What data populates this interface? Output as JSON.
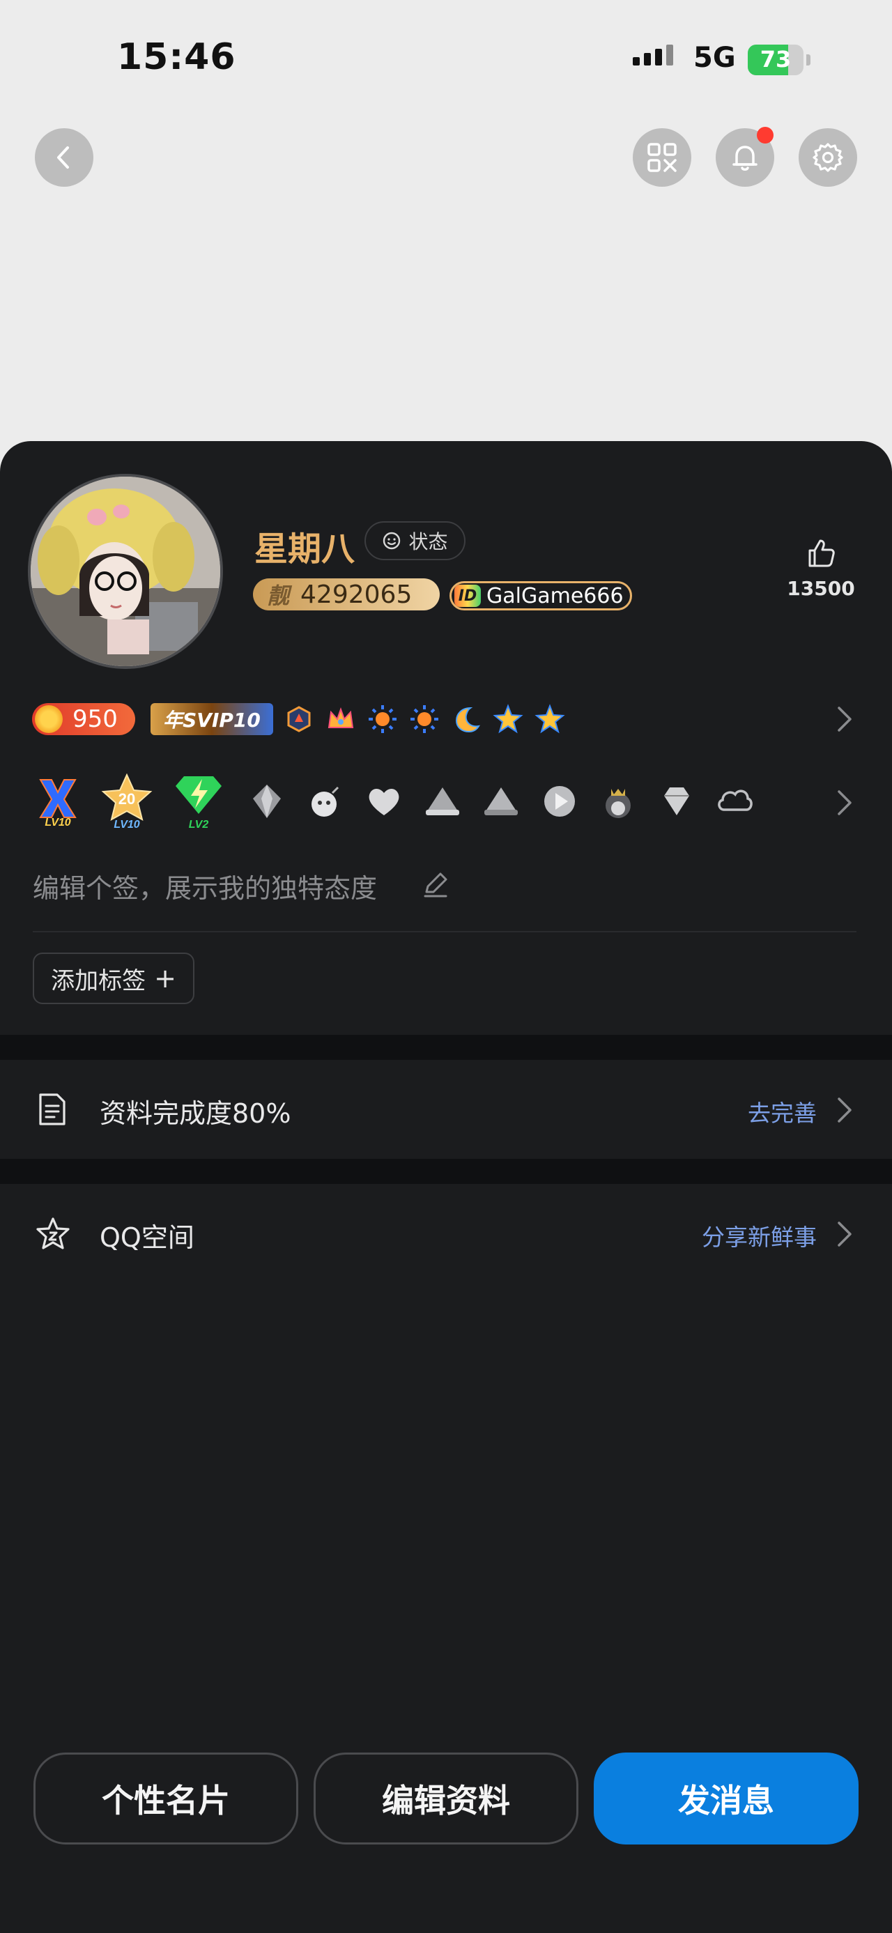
{
  "status_bar": {
    "time": "15:46",
    "network": "5G",
    "battery": "73",
    "battery_level": 0.73
  },
  "profile": {
    "name": "星期八",
    "status_label": "状态",
    "qq_id_prefix": "靓",
    "qq_id": "4292065",
    "game_tag": "GalGame666",
    "game_tag_logo": "ID",
    "likes": "13500"
  },
  "badges": {
    "coins": "950",
    "svip_label": "年SVIP10",
    "lv_x": "LV10",
    "lv_20_top": "20",
    "lv_20_bottom": "LV10",
    "lv_2": "LV2"
  },
  "signature_placeholder": "编辑个签，展示我的独特态度",
  "add_tag_label": "添加标签",
  "add_tag_icon": "+",
  "sections": [
    {
      "label": "资料完成度80%",
      "action": "去完善"
    },
    {
      "label": "QQ空间",
      "action": "分享新鲜事"
    }
  ],
  "buttons": {
    "card": "个性名片",
    "edit": "编辑资料",
    "message": "发消息"
  },
  "colors": {
    "accent": "#0a7fdf",
    "name_gold": "#e8b26a",
    "link_blue": "#7c9fe6",
    "dark_bg": "#1b1c1e"
  }
}
